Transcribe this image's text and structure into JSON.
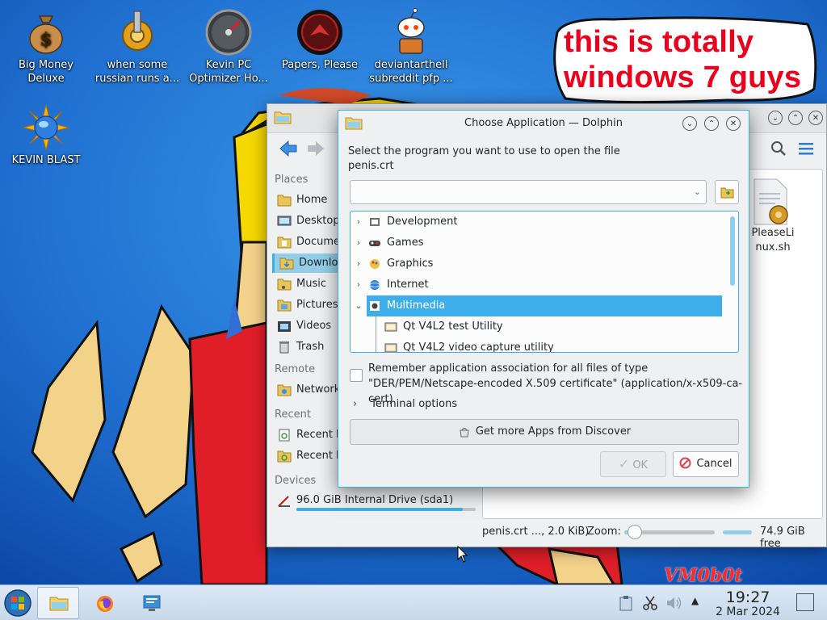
{
  "desktop": {
    "icons": [
      {
        "label": "Big Money Deluxe",
        "icon": "money-bag-icon"
      },
      {
        "label": "when some russian runs a...",
        "icon": "gear-icon"
      },
      {
        "label": "Kevin PC Optimizer Ho...",
        "icon": "speedometer-icon"
      },
      {
        "label": "Papers, Please",
        "icon": "papers-please-icon"
      },
      {
        "label": "deviantarthell subreddit pfp ...",
        "icon": "reddit-snoo-icon"
      },
      {
        "label": "KEVIN BLAST",
        "icon": "sun-globe-icon"
      }
    ],
    "bubble_text": "this is totally windows 7 guys",
    "watermark": "VM0b0t"
  },
  "dolphin": {
    "places": {
      "places_header": "Places",
      "places": [
        "Home",
        "Desktop",
        "Documents",
        "Downloads",
        "Music",
        "Pictures",
        "Videos",
        "Trash"
      ],
      "active": "Downloads",
      "remote_header": "Remote",
      "remote": [
        "Network"
      ],
      "recent_header": "Recent",
      "recent": [
        "Recent Files",
        "Recent Locations"
      ],
      "devices_header": "Devices",
      "device": "96.0 GiB Internal Drive (sda1)",
      "device_used_fraction": 0.93
    },
    "file": {
      "name": "PleaseLinux.sh"
    },
    "status": {
      "selection": "penis.crt ..., 2.0 KiB)",
      "zoom_label": "Zoom:",
      "zoom_fraction": 0.05,
      "free": "74.9 GiB free"
    }
  },
  "dialog": {
    "title": "Choose Application — Dolphin",
    "prompt_line1": "Select the program you want to use to open the file",
    "prompt_line2": "penis.crt",
    "combo_value": "",
    "tree": [
      {
        "label": "Development",
        "expanded": false,
        "icon": "development-icon"
      },
      {
        "label": "Games",
        "expanded": false,
        "icon": "games-icon"
      },
      {
        "label": "Graphics",
        "expanded": false,
        "icon": "graphics-icon"
      },
      {
        "label": "Internet",
        "expanded": false,
        "icon": "internet-icon"
      },
      {
        "label": "Multimedia",
        "expanded": true,
        "selected": true,
        "icon": "multimedia-icon"
      },
      {
        "label": "Qt V4L2 test Utility",
        "child": true,
        "icon": "application-icon"
      },
      {
        "label": "Qt V4L2 video capture utility",
        "child": true,
        "icon": "application-icon"
      }
    ],
    "remember_line1": "Remember application association for all files of type",
    "remember_line2": "\"DER/PEM/Netscape-encoded X.509 certificate\" (application/x-x509-ca-cert)",
    "remember_checked": false,
    "terminal_options": "Terminal options",
    "discover_button": "Get more Apps from Discover",
    "ok_button": "OK",
    "cancel_button": "Cancel"
  },
  "taskbar": {
    "time": "19:27",
    "date": "2 Mar 2024"
  },
  "colors": {
    "accent": "#3daee9",
    "selection": "#93cee9",
    "bubble_text": "#e8001c"
  }
}
